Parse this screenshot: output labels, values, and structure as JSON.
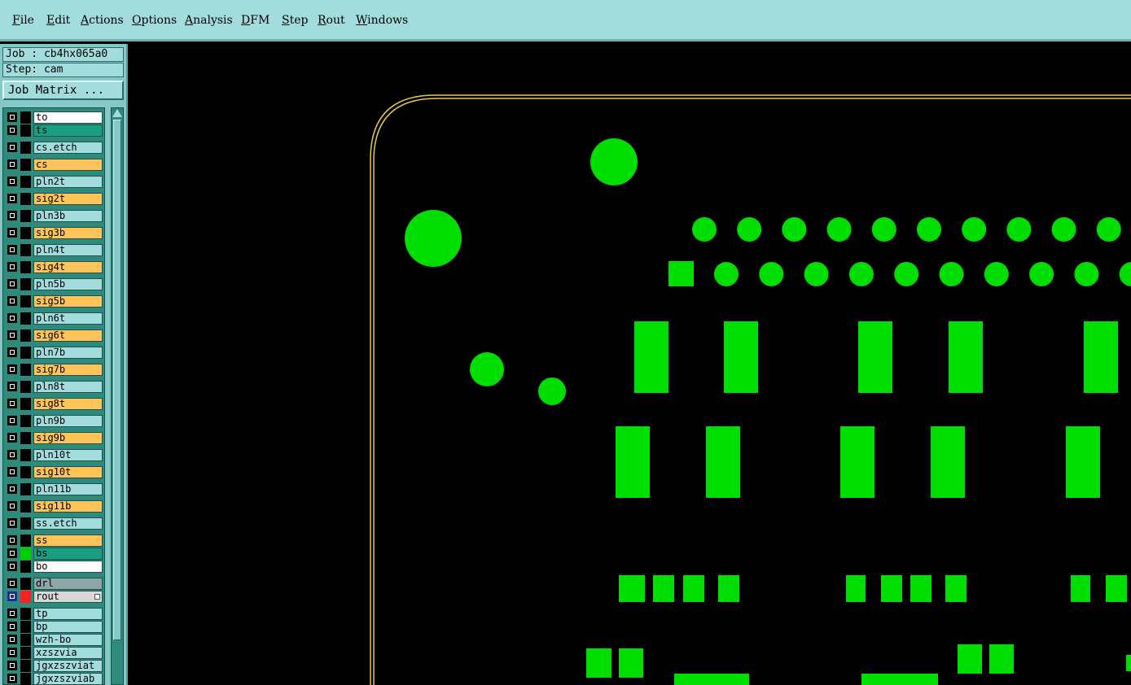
{
  "menubar": {
    "items": [
      "File",
      "Edit",
      "Actions",
      "Options",
      "Analysis",
      "DFM",
      "Step",
      "Rout",
      "Windows"
    ]
  },
  "job": {
    "label": "Job : cb4hx065a0"
  },
  "step": {
    "label": "Step: cam"
  },
  "job_matrix": {
    "label": "Job Matrix ..."
  },
  "colors": {
    "layer_white": "#ffffff",
    "layer_teal": "#18a080",
    "layer_cyan": "#a2dcdc",
    "layer_orange": "#ffc457",
    "layer_gray": "#8fa6a8",
    "layer_light": "#d8d8d8",
    "pad_green": "#00dd00",
    "outline_yellow": "#e6c84a"
  },
  "layers": [
    {
      "name": "to",
      "style": "white"
    },
    {
      "name": "ts",
      "style": "teal"
    },
    {
      "name": "cs.etch",
      "style": "cyan"
    },
    {
      "name": "cs",
      "style": "orange"
    },
    {
      "name": "pln2t",
      "style": "cyan"
    },
    {
      "name": "sig2t",
      "style": "orange"
    },
    {
      "name": "pln3b",
      "style": "cyan"
    },
    {
      "name": "sig3b",
      "style": "orange"
    },
    {
      "name": "pln4t",
      "style": "cyan"
    },
    {
      "name": "sig4t",
      "style": "orange"
    },
    {
      "name": "pln5b",
      "style": "cyan"
    },
    {
      "name": "sig5b",
      "style": "orange"
    },
    {
      "name": "pln6t",
      "style": "cyan"
    },
    {
      "name": "sig6t",
      "style": "orange"
    },
    {
      "name": "pln7b",
      "style": "cyan"
    },
    {
      "name": "sig7b",
      "style": "orange"
    },
    {
      "name": "pln8t",
      "style": "cyan"
    },
    {
      "name": "sig8t",
      "style": "orange"
    },
    {
      "name": "pln9b",
      "style": "cyan"
    },
    {
      "name": "sig9b",
      "style": "orange"
    },
    {
      "name": "pln10t",
      "style": "cyan"
    },
    {
      "name": "sig10t",
      "style": "orange"
    },
    {
      "name": "pln11b",
      "style": "cyan"
    },
    {
      "name": "sig11b",
      "style": "orange"
    },
    {
      "name": "ss.etch",
      "style": "cyan"
    },
    {
      "name": "ss",
      "style": "orange"
    },
    {
      "name": "bs",
      "style": "teal",
      "color": "green"
    },
    {
      "name": "bo",
      "style": "white"
    },
    {
      "name": "drl",
      "style": "gray"
    },
    {
      "name": "rout",
      "style": "light",
      "color": "red",
      "checkbox": "blue",
      "corner": true
    },
    {
      "name": "tp",
      "style": "cyan"
    },
    {
      "name": "bp",
      "style": "cyan"
    },
    {
      "name": "wzh-bo",
      "style": "cyan"
    },
    {
      "name": "xzszvia",
      "style": "cyan"
    },
    {
      "name": "jgxzszviat",
      "style": "cyan"
    },
    {
      "name": "jgxzszviab",
      "style": "cyan"
    }
  ]
}
